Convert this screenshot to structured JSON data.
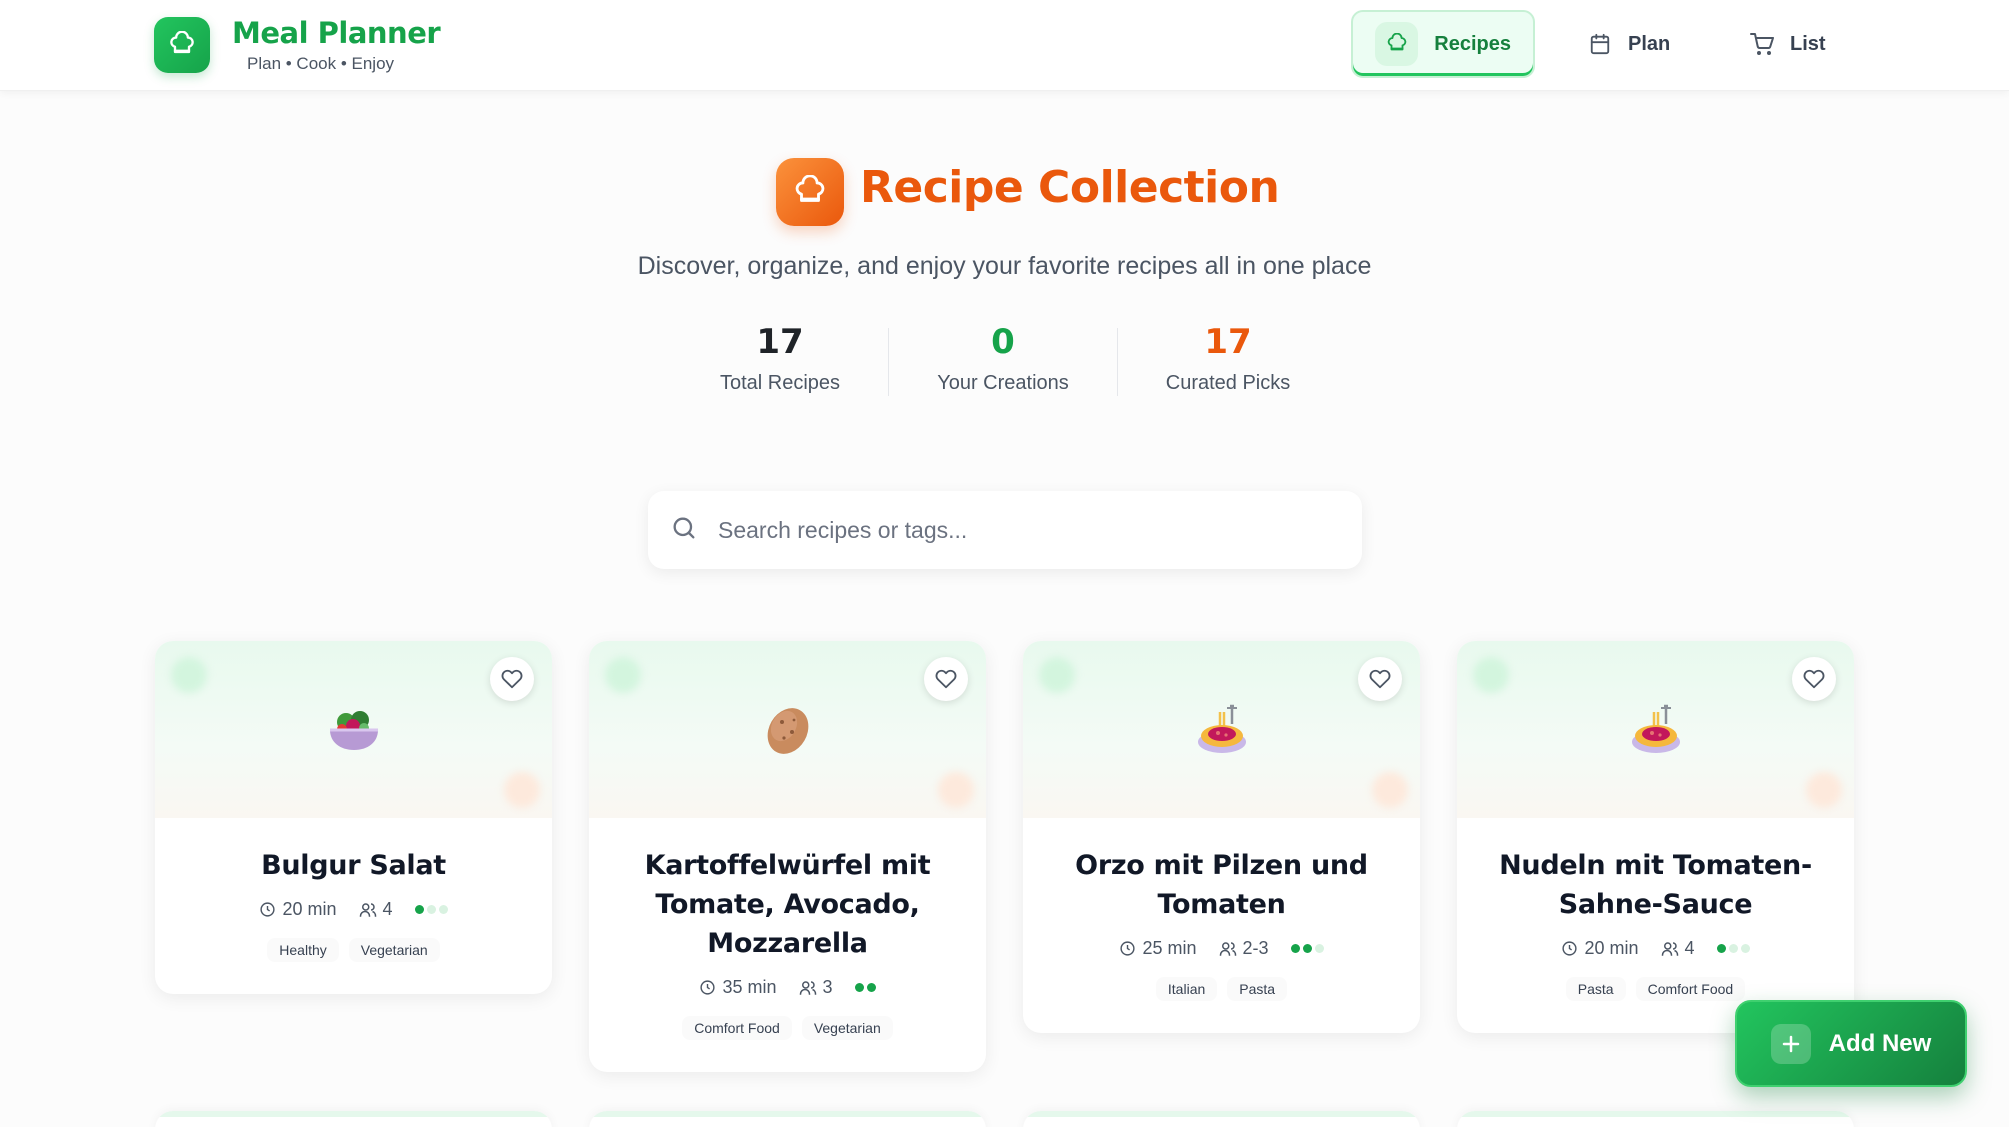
{
  "brand": {
    "title": "Meal Planner",
    "tagline": "Plan • Cook • Enjoy"
  },
  "nav": [
    {
      "label": "Recipes",
      "icon": "chef-hat-icon",
      "active": true
    },
    {
      "label": "Plan",
      "icon": "calendar-icon",
      "active": false
    },
    {
      "label": "List",
      "icon": "shopping-cart-icon",
      "active": false
    }
  ],
  "hero": {
    "title": "Recipe Collection",
    "subtitle": "Discover, organize, and enjoy your favorite recipes all in one place"
  },
  "stats": [
    {
      "value": "17",
      "label": "Total Recipes",
      "color": "#1f2328"
    },
    {
      "value": "0",
      "label": "Your Creations",
      "color": "#16a34a"
    },
    {
      "value": "17",
      "label": "Curated Picks",
      "color": "#ea580c"
    }
  ],
  "search": {
    "placeholder": "Search recipes or tags...",
    "value": ""
  },
  "recipes": [
    {
      "title": "Bulgur Salat",
      "time": "20 min",
      "servings": "4",
      "difficulty": 1,
      "tags": [
        "Healthy",
        "Vegetarian"
      ],
      "image": "salad-bowl-icon"
    },
    {
      "title": "Kartoffelwürfel mit Tomate, Avocado, Mozzarella",
      "time": "35 min",
      "servings": "3",
      "difficulty": 2,
      "tags": [
        "Comfort Food",
        "Vegetarian"
      ],
      "image": "potato-icon"
    },
    {
      "title": "Orzo mit Pilzen und Tomaten",
      "time": "25 min",
      "servings": "2-3",
      "difficulty": 2,
      "tags": [
        "Italian",
        "Pasta"
      ],
      "image": "spaghetti-icon"
    },
    {
      "title": "Nudeln mit Tomaten-Sahne-Sauce",
      "time": "20 min",
      "servings": "4",
      "difficulty": 1,
      "tags": [
        "Pasta",
        "Comfort Food"
      ],
      "image": "spaghetti-icon"
    }
  ],
  "fab": {
    "label": "Add New"
  },
  "colors": {
    "brand_green": "#16a34a",
    "accent_orange": "#ea580c",
    "active_nav_bg": "#ecfdf3"
  }
}
